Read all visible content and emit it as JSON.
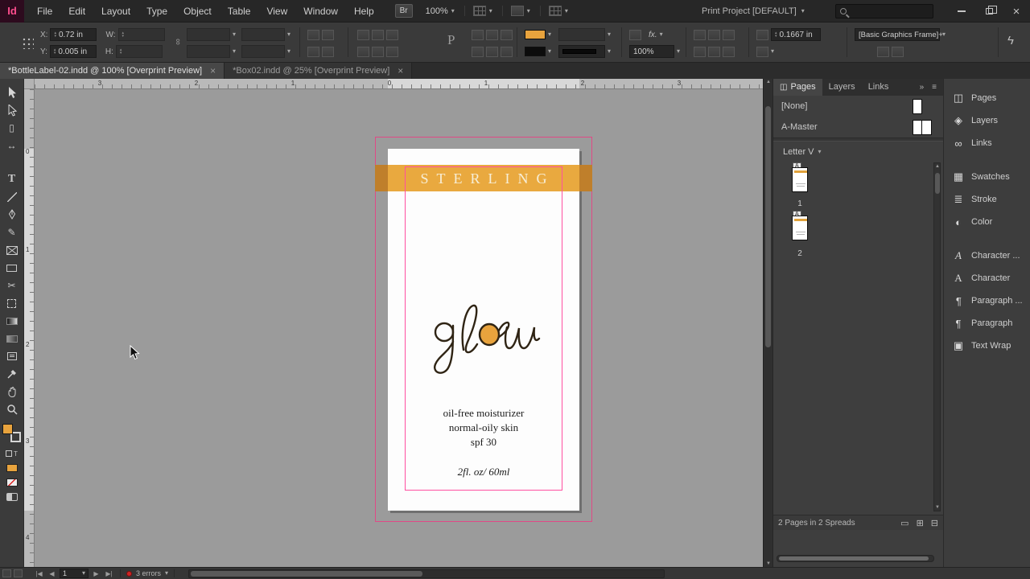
{
  "menubar": {
    "logo": "Id",
    "items": [
      "File",
      "Edit",
      "Layout",
      "Type",
      "Object",
      "Table",
      "View",
      "Window",
      "Help"
    ],
    "bridge": "Br",
    "zoom": "100%",
    "workspace": "Print Project [DEFAULT]"
  },
  "control_panel": {
    "x_label": "X:",
    "x_value": "0.72 in",
    "y_label": "Y:",
    "y_value": "0.005 in",
    "w_label": "W:",
    "h_label": "H:",
    "p_label": "P",
    "fx_label": "fx.",
    "opacity": "100%",
    "corner_radius": "0.1667 in",
    "object_style": "[Basic Graphics Frame]+"
  },
  "document_tabs": [
    {
      "label": "*BottleLabel-02.indd @ 100% [Overprint Preview]"
    },
    {
      "label": "*Box02.indd @ 25% [Overprint Preview]"
    }
  ],
  "toolbar": {
    "tools": [
      "selection",
      "direct-selection",
      "page",
      "gap",
      "type",
      "line",
      "pen",
      "pencil",
      "rectangle-frame",
      "rectangle",
      "scissors",
      "free-transform",
      "gradient-swatch",
      "gradient-feather",
      "note",
      "eyedropper",
      "hand",
      "zoom"
    ]
  },
  "rulers": {
    "horizontal": [
      "3",
      "2",
      "1",
      "0",
      "1",
      "2",
      "3"
    ],
    "vertical": [
      "0",
      "1",
      "2",
      "3",
      "4"
    ]
  },
  "artboard": {
    "brand": "STERLING",
    "logo_word": "glow",
    "desc_lines": [
      "oil-free moisturizer",
      "normal-oily skin",
      "spf 30"
    ],
    "volume": "2fl. oz/ 60ml",
    "band_color": "#e9a93f",
    "band_edge_color": "#bf7f2b",
    "guide_color": "#ff4fa0",
    "frame_color": "#e04a86"
  },
  "pages_panel": {
    "tabs": [
      "Pages",
      "Layers",
      "Links"
    ],
    "masters": [
      {
        "name": "[None]"
      },
      {
        "name": "A-Master"
      }
    ],
    "size_selector": "Letter V",
    "master_badge": "A",
    "pages": [
      {
        "number": "1"
      },
      {
        "number": "2"
      }
    ],
    "status": "2 Pages in 2 Spreads"
  },
  "dock": {
    "groups": [
      [
        "Pages",
        "Layers",
        "Links"
      ],
      [
        "Swatches",
        "Stroke",
        "Color"
      ],
      [
        "Character ...",
        "Character",
        "Paragraph ...",
        "Paragraph",
        "Text Wrap"
      ]
    ]
  },
  "statusbar": {
    "page": "1",
    "errors": "3 errors"
  }
}
